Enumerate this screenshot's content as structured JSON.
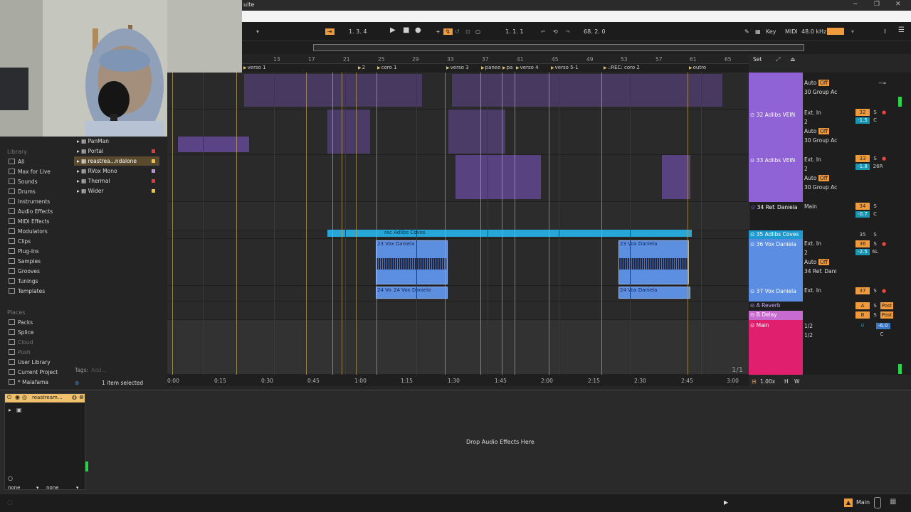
{
  "window": {
    "title_fragment": "uite",
    "controls": [
      "−",
      "❐",
      "✕"
    ]
  },
  "transport": {
    "arrangement_position": "1.  3.  4",
    "loop_start": "1.   1.   1",
    "loop_length": "68.   2.   0",
    "key_label": "Key",
    "midi_label": "MIDI",
    "sample_rate": "48.0 kHz"
  },
  "ruler_ticks": [
    "13",
    "17",
    "21",
    "25",
    "29",
    "33",
    "37",
    "41",
    "45",
    "49",
    "53",
    "57",
    "61",
    "65"
  ],
  "locators": [
    "verso 1",
    "2",
    "coro 1",
    "verso 3",
    "paneo",
    "pa",
    "verso 4",
    "verso 5-1",
    ".:REC: coro 2",
    "outro"
  ],
  "set_button": "Set",
  "clips": {
    "cyan_label": "rec Adlibs Coves",
    "blue1_top": "23 Vox Daniela",
    "blue1_bottom": "24 Vox Daniela",
    "blue1_bottom_short": "24 Vo",
    "blue2_top": "23 Vox Daniela",
    "blue2_bottom": "24 Vox Daniela"
  },
  "timeline": [
    "0:00",
    "0:15",
    "0:30",
    "0:45",
    "1:00",
    "1:15",
    "1:30",
    "1:45",
    "2:00",
    "2:15",
    "2:30",
    "2:45",
    "3:00"
  ],
  "page_count": "1/1",
  "zoom": "1.00x",
  "view_buttons": [
    "H",
    "W"
  ],
  "tracks": [
    {
      "name": "",
      "color": "#8f63d6",
      "input": "",
      "channel": "",
      "monitor": "Auto",
      "off": "Off",
      "output": "30 Group Ac",
      "num": "",
      "vol": "−∞",
      "pan": "−∞"
    },
    {
      "name": "32 Adlibs VEIN",
      "color": "#8f63d6",
      "input": "Ext. In",
      "channel": "2",
      "monitor": "Auto",
      "off": "Off",
      "output": "30 Group Ac",
      "num": "32",
      "vol": "-1.5",
      "pan": "C"
    },
    {
      "name": "33 Adlibs VEIN",
      "color": "#8f63d6",
      "input": "Ext. In",
      "channel": "2",
      "monitor": "Auto",
      "off": "Off",
      "output": "30 Group Ac",
      "num": "33",
      "vol": "-1.8",
      "pan": "26R"
    },
    {
      "name": "34 Ref. Daniela",
      "color": "#1e1e1e",
      "input": "Main",
      "channel": "",
      "monitor": "",
      "off": "",
      "output": "",
      "num": "34",
      "vol": "-0.7",
      "pan": "C"
    },
    {
      "name": "35 Adlibs Coves",
      "color": "#1e9ad0",
      "input": "",
      "channel": "",
      "monitor": "",
      "off": "",
      "output": "",
      "num": "35",
      "vol": "",
      "pan": ""
    },
    {
      "name": "36 Vox Daniela",
      "color": "#5b8de2",
      "input": "Ext. In",
      "channel": "2",
      "monitor": "Auto",
      "off": "Off",
      "output": "34 Ref. Dani",
      "num": "36",
      "vol": "-2.5",
      "pan": "6L"
    },
    {
      "name": "37 Vox Daniela",
      "color": "#5b8de2",
      "input": "Ext. In",
      "channel": "",
      "monitor": "",
      "off": "",
      "output": "",
      "num": "37",
      "vol": "",
      "pan": ""
    }
  ],
  "returns": [
    {
      "name": "A Reverb",
      "letter": "A",
      "post": "Post"
    },
    {
      "name": "B Delay",
      "letter": "B",
      "post": "Post"
    }
  ],
  "main_track": {
    "name": "Main",
    "in": "1/2",
    "out": "1/2",
    "num": "0",
    "vol": "-6.0",
    "pan": "C",
    "inf": "−∞"
  },
  "browser": {
    "library_title": "Library",
    "library_items": [
      "All",
      "Max for Live",
      "Sounds",
      "Drums",
      "Instruments",
      "Audio Effects",
      "MIDI Effects",
      "Modulators",
      "Clips",
      "Plug-Ins",
      "Samples",
      "Grooves",
      "Tunings",
      "Templates"
    ],
    "places_title": "Places",
    "places_items": [
      "Packs",
      "Splice",
      "Cloud",
      "Push",
      "User Library",
      "Current Project",
      "* Malafama"
    ],
    "file_items": [
      {
        "name": "PanMan",
        "dot": ""
      },
      {
        "name": "Portal",
        "dot": "#e03a3a"
      },
      {
        "name": "reastrea...ndalone",
        "dot": "#f0c040"
      },
      {
        "name": "RVox Mono",
        "dot": "#c08be0"
      },
      {
        "name": "Thermal",
        "dot": "#e03a3a"
      },
      {
        "name": "Wider",
        "dot": "#f0c040"
      }
    ],
    "tags_label": "Tags:",
    "tags_add": "Add...",
    "selection": "1 item selected"
  },
  "device": {
    "title": "reastream...",
    "select1": "none",
    "select2": "none",
    "drop_text": "Drop Audio Effects Here"
  },
  "status": {
    "main_label": "Main"
  },
  "colors": {
    "accent": "#f09a3e",
    "purple": "#8f63d6",
    "blue": "#5b8de2",
    "cyan": "#27a6d8",
    "main": "#e0206e"
  }
}
